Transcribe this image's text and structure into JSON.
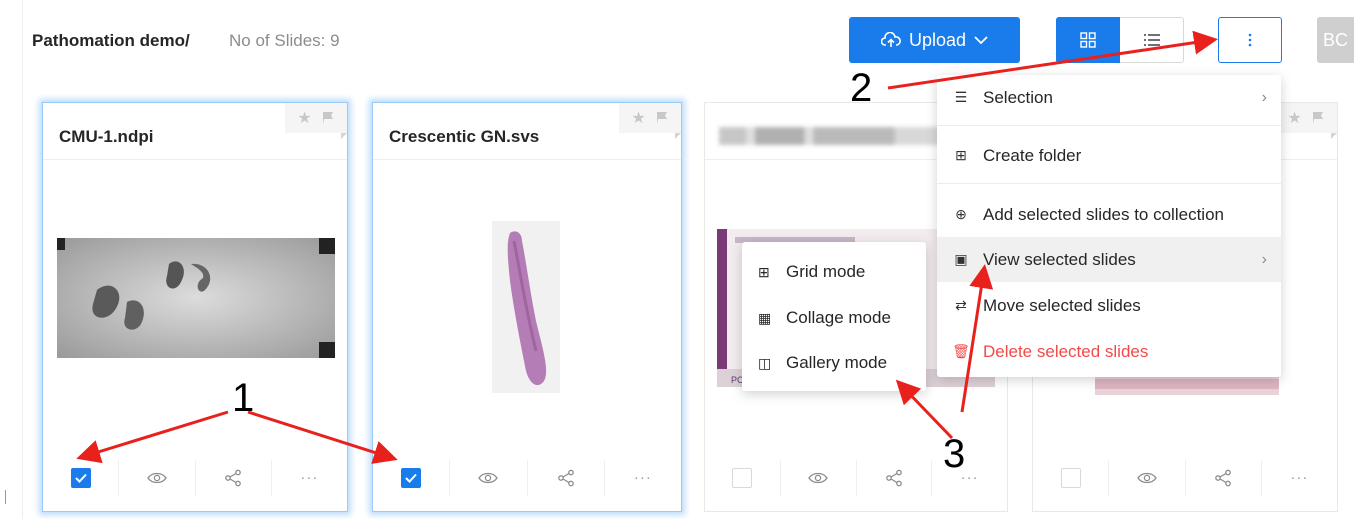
{
  "header": {
    "title": "Pathomation demo/",
    "slide_count": "No of Slides: 9",
    "upload_label": "Upload",
    "avatar_initials": "BC"
  },
  "cards": [
    {
      "title": "CMU-1.ndpi",
      "checked": true,
      "selected": true
    },
    {
      "title": "Crescentic GN.svs",
      "checked": true,
      "selected": true
    },
    {
      "title": "",
      "checked": false,
      "selected": false
    },
    {
      "title": "",
      "checked": false,
      "selected": false
    }
  ],
  "card_footer": {
    "more_label": "···"
  },
  "dropdown": {
    "items": [
      {
        "label": "Selection",
        "icon": "list-icon",
        "has_submenu": true
      },
      {
        "label": "Create folder",
        "icon": "folder-plus-icon"
      },
      {
        "label": "Add selected slides to collection",
        "icon": "collection-icon"
      },
      {
        "label": "View selected slides",
        "icon": "folder-view-icon",
        "has_submenu": true
      },
      {
        "label": "Move selected slides",
        "icon": "move-icon"
      },
      {
        "label": "Delete selected slides",
        "icon": "trash-icon",
        "danger": true
      }
    ]
  },
  "submenu": {
    "items": [
      {
        "label": "Grid mode",
        "icon": "grid-icon"
      },
      {
        "label": "Collage mode",
        "icon": "table-icon"
      },
      {
        "label": "Gallery mode",
        "icon": "gallery-icon"
      }
    ]
  },
  "annotations": {
    "one": "1",
    "two": "2",
    "three": "3"
  },
  "colors": {
    "primary": "#1a7bea",
    "danger": "#f24a4a",
    "annotation_arrow": "#e8211d"
  }
}
